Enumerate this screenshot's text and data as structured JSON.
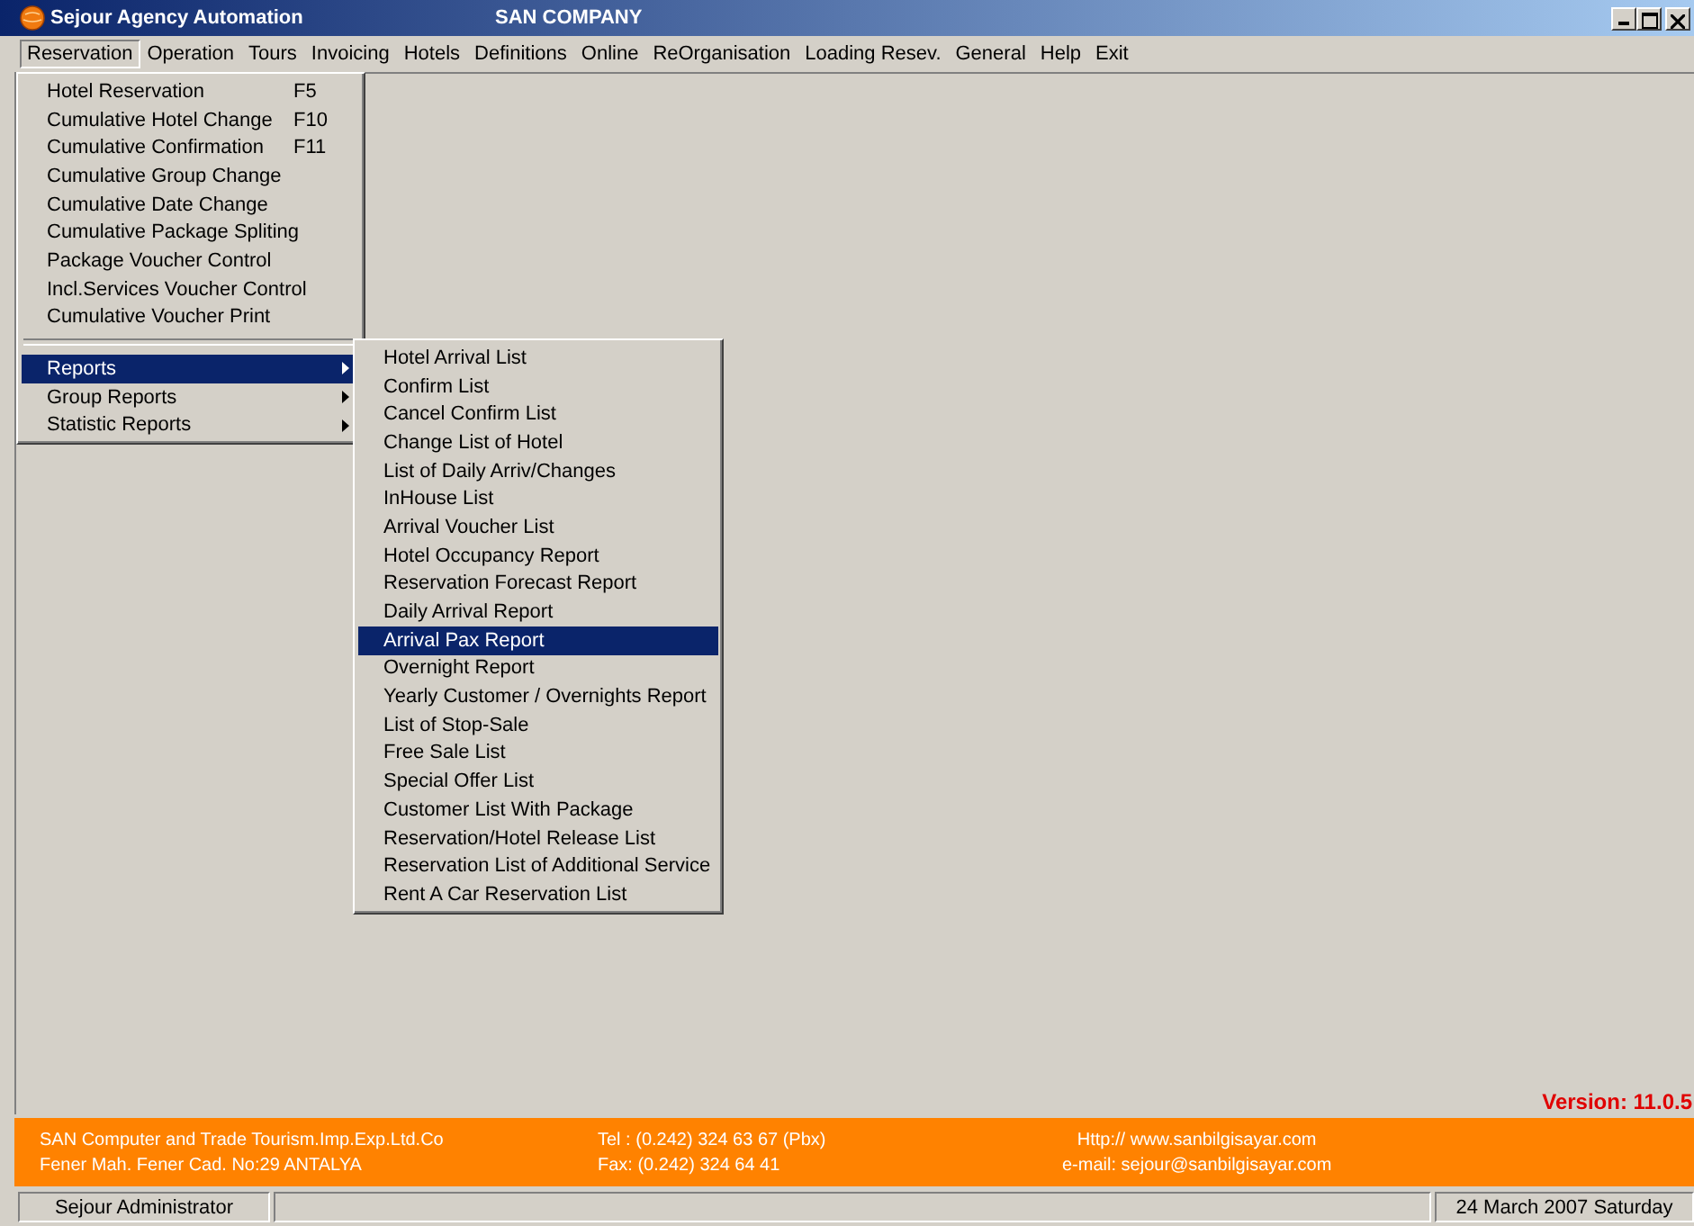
{
  "window": {
    "title": "Sejour Agency Automation",
    "company": "SAN COMPANY"
  },
  "menubar": [
    {
      "label": "Reservation",
      "selected": true
    },
    {
      "label": "Operation",
      "selected": false
    },
    {
      "label": "Tours",
      "selected": false
    },
    {
      "label": "Invoicing",
      "selected": false
    },
    {
      "label": "Hotels",
      "selected": false
    },
    {
      "label": "Definitions",
      "selected": false
    },
    {
      "label": "Online",
      "selected": false
    },
    {
      "label": "ReOrganisation",
      "selected": false
    },
    {
      "label": "Loading Resev.",
      "selected": false
    },
    {
      "label": "General",
      "selected": false
    },
    {
      "label": "Help",
      "selected": false
    },
    {
      "label": "Exit",
      "selected": false
    }
  ],
  "menu": [
    {
      "kind": "item",
      "label": "Hotel Reservation",
      "shortcut": "F5",
      "selected": false
    },
    {
      "kind": "item",
      "label": "Cumulative Hotel Change",
      "shortcut": "F10",
      "selected": false
    },
    {
      "kind": "item",
      "label": "Cumulative Confirmation",
      "shortcut": "F11",
      "selected": false
    },
    {
      "kind": "item",
      "label": "Cumulative Group Change",
      "selected": false
    },
    {
      "kind": "item",
      "label": "Cumulative Date Change",
      "selected": false
    },
    {
      "kind": "item",
      "label": "Cumulative Package Spliting",
      "selected": false
    },
    {
      "kind": "item",
      "label": "Package Voucher Control",
      "selected": false
    },
    {
      "kind": "item",
      "label": "Incl.Services Voucher Control",
      "selected": false
    },
    {
      "kind": "item",
      "label": "Cumulative Voucher Print",
      "selected": false
    },
    {
      "kind": "separator"
    },
    {
      "kind": "submenu",
      "label": "Reports",
      "selected": true
    },
    {
      "kind": "submenu",
      "label": "Group Reports",
      "selected": false
    },
    {
      "kind": "submenu",
      "label": "Statistic Reports",
      "selected": false
    }
  ],
  "submenu": [
    {
      "label": "Hotel Arrival List",
      "selected": false
    },
    {
      "label": "Confirm List",
      "selected": false
    },
    {
      "label": "Cancel Confirm List",
      "selected": false
    },
    {
      "label": "Change List of Hotel",
      "selected": false
    },
    {
      "label": "List of Daily Arriv/Changes",
      "selected": false
    },
    {
      "label": "InHouse List",
      "selected": false
    },
    {
      "label": "Arrival Voucher List",
      "selected": false
    },
    {
      "label": "Hotel Occupancy Report",
      "selected": false
    },
    {
      "label": "Reservation Forecast Report",
      "selected": false
    },
    {
      "label": "Daily Arrival Report",
      "selected": false
    },
    {
      "label": "Arrival Pax Report",
      "selected": true
    },
    {
      "label": "Overnight Report",
      "selected": false
    },
    {
      "label": "Yearly Customer / Overnights Report",
      "selected": false
    },
    {
      "label": "List of Stop-Sale",
      "selected": false
    },
    {
      "label": "Free Sale List",
      "selected": false
    },
    {
      "label": "Special Offer List",
      "selected": false
    },
    {
      "label": "Customer List With Package",
      "selected": false
    },
    {
      "label": "Reservation/Hotel Release List",
      "selected": false
    },
    {
      "label": "Reservation List of Additional Service",
      "selected": false
    },
    {
      "label": "Rent A Car Reservation List",
      "selected": false
    }
  ],
  "version": "Version: 11.0.5",
  "footer": {
    "company": "SAN Computer and Trade Tourism.Imp.Exp.Ltd.Co",
    "address": "Fener Mah. Fener Cad. No:29 ANTALYA",
    "tel": "Tel : (0.242) 324 63 67 (Pbx)",
    "fax": "Fax: (0.242) 324 64 41",
    "web": "Http:// www.sanbilgisayar.com",
    "email": "e-mail: sejour@sanbilgisayar.com"
  },
  "status_bar": {
    "user": "Sejour Administrator",
    "date": "24 March 2007 Saturday"
  }
}
